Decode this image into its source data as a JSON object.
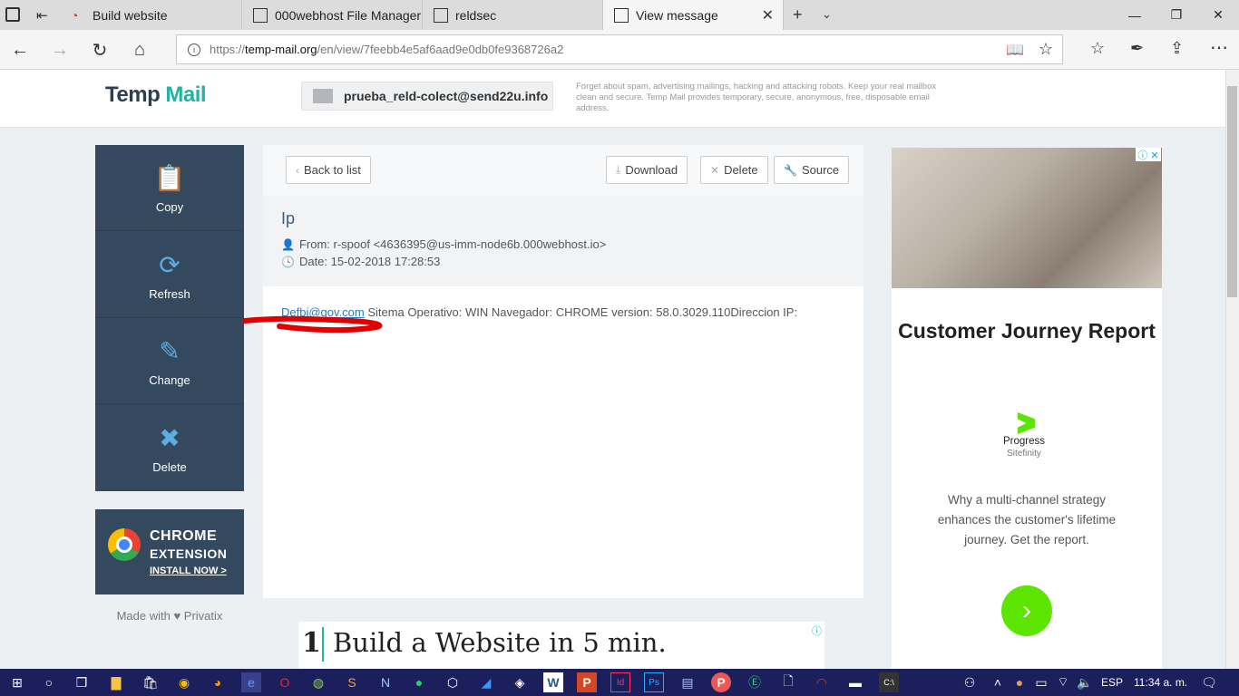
{
  "browser": {
    "tabs": [
      {
        "label": "Build website"
      },
      {
        "label": "000webhost File Manager"
      },
      {
        "label": "reldsec"
      },
      {
        "label": "View message"
      }
    ],
    "url_prefix": "https://",
    "url_domain": "temp-mail.org",
    "url_path": "/en/view/7feebb4e5af6aad9e0db0fe9368726a2"
  },
  "header": {
    "logo_a": "Temp",
    "logo_b": "Mail",
    "email": "prueba_reld-colect@send22u.info",
    "description": "Forget about spam, advertising mailings, hacking and attacking robots. Keep your real mailbox clean and secure. Temp Mail provides temporary, secure, anonymous, free, disposable email address."
  },
  "sidebar": {
    "items": [
      {
        "label": "Copy",
        "icon": "clipboard-icon"
      },
      {
        "label": "Refresh",
        "icon": "refresh-icon"
      },
      {
        "label": "Change",
        "icon": "edit-icon"
      },
      {
        "label": "Delete",
        "icon": "close-icon"
      }
    ],
    "chrome_title1": "CHROME",
    "chrome_title2": "EXTENSION",
    "chrome_cta": "INSTALL NOW >",
    "made_with": "Made with ♥ Privatix"
  },
  "message": {
    "back_label": "Back to list",
    "download_label": "Download",
    "delete_label": "Delete",
    "source_label": "Source",
    "subject": "Ip",
    "from": "From: r-spoof <4636395@us-imm-node6b.000webhost.io>",
    "date": "Date: 15-02-2018 17:28:53",
    "body_link": "Defbi@gov.com",
    "body_text": " Sitema Operativo: WIN Navegador: CHROME version: 58.0.3029.110Direccion IP:"
  },
  "ad": {
    "title": "Customer Journey Report",
    "brand": "Progress",
    "brand_sub": "Sitefinity",
    "text": "Why a multi-channel strategy enhances the customer's lifetime journey. Get the report.",
    "banner_num": "1",
    "banner_text": "Build a Website in 5 min."
  },
  "taskbar": {
    "lang": "ESP",
    "time": "11:34 a. m."
  }
}
